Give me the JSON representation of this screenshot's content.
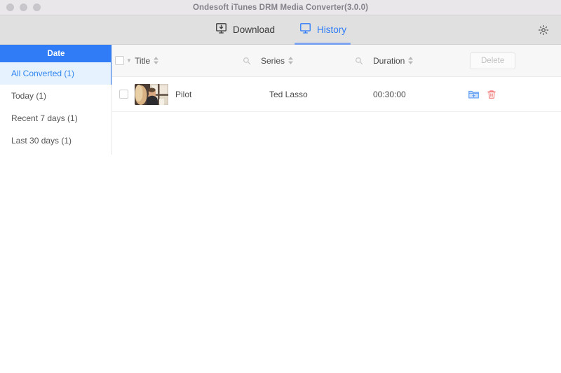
{
  "window": {
    "title": "Ondesoft iTunes DRM Media Converter(3.0.0)",
    "traffic_lights": [
      "close",
      "minimize",
      "maximize"
    ],
    "accent_color": "#2f7cf6"
  },
  "toolbar": {
    "tabs": [
      {
        "label": "Download",
        "icon": "download-monitor-icon",
        "active": false
      },
      {
        "label": "History",
        "icon": "monitor-icon",
        "active": true
      }
    ],
    "settings_icon": "gear-icon"
  },
  "sidebar": {
    "header": "Date",
    "items": [
      {
        "label": "All Converted (1)",
        "selected": true
      },
      {
        "label": "Today (1)",
        "selected": false
      },
      {
        "label": "Recent 7 days (1)",
        "selected": false
      },
      {
        "label": "Last 30 days (1)",
        "selected": false
      }
    ]
  },
  "table": {
    "select_all_checked": false,
    "columns": [
      {
        "key": "title",
        "label": "Title",
        "sortable": true,
        "search_icon": "search-icon"
      },
      {
        "key": "series",
        "label": "Series",
        "sortable": true,
        "search_icon": "search-icon"
      },
      {
        "key": "duration",
        "label": "Duration",
        "sortable": true,
        "search_icon": null
      }
    ],
    "delete_button": {
      "label": "Delete",
      "disabled": true
    },
    "rows": [
      {
        "checked": false,
        "thumbnail": "video-thumbnail",
        "title": "Pilot",
        "series": "Ted Lasso",
        "duration": "00:30:00",
        "actions": [
          {
            "name": "open-folder-icon",
            "color": "#5b9bf5"
          },
          {
            "name": "delete-icon",
            "color": "#f26b6b"
          }
        ]
      }
    ]
  }
}
